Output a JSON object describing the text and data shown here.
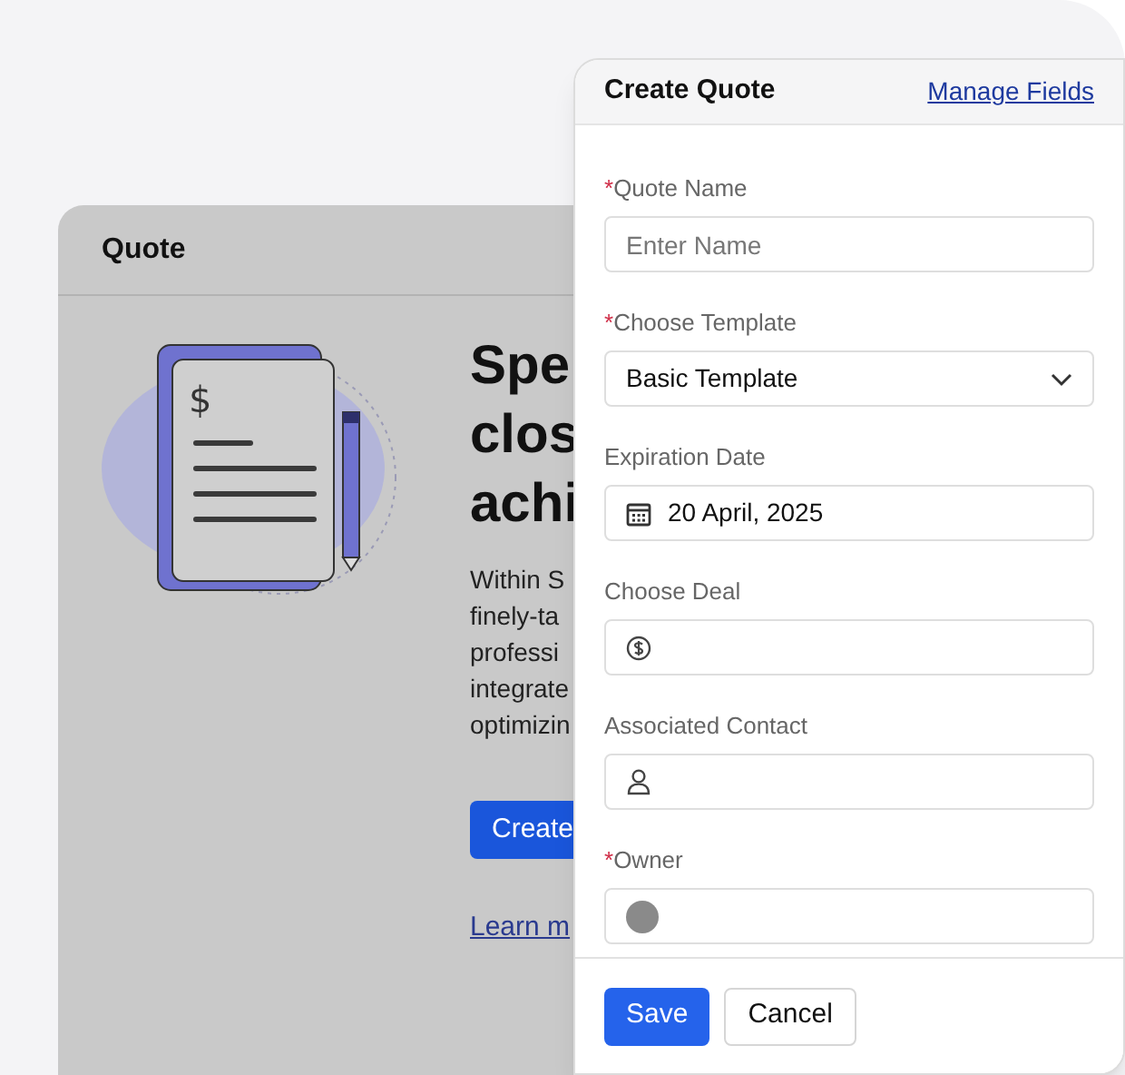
{
  "background_card": {
    "title": "Quote",
    "document_symbol": "$",
    "heading_lines": [
      "Spe",
      "clos",
      "achi"
    ],
    "body_lines": [
      "Within S",
      "finely-ta",
      "professi",
      "integrate",
      "optimizin"
    ],
    "primary_button": "Create",
    "link": "Learn m"
  },
  "modal": {
    "title": "Create Quote",
    "header_link": "Manage Fields",
    "required_symbol": "*",
    "fields": [
      {
        "kind": "text",
        "label": "Quote Name",
        "required": true,
        "placeholder": "Enter Name"
      },
      {
        "kind": "select",
        "label": "Choose Template",
        "required": true,
        "value": "Basic Template"
      },
      {
        "kind": "date",
        "label": "Expiration Date",
        "required": false,
        "value": "20 April, 2025"
      },
      {
        "kind": "deal",
        "label": "Choose Deal",
        "required": false
      },
      {
        "kind": "contact",
        "label": "Associated Contact",
        "required": false
      },
      {
        "kind": "owner",
        "label": "Owner",
        "required": true
      }
    ],
    "buttons": [
      {
        "kind": "primary",
        "label": "Save"
      },
      {
        "kind": "secondary",
        "label": "Cancel"
      }
    ]
  }
}
